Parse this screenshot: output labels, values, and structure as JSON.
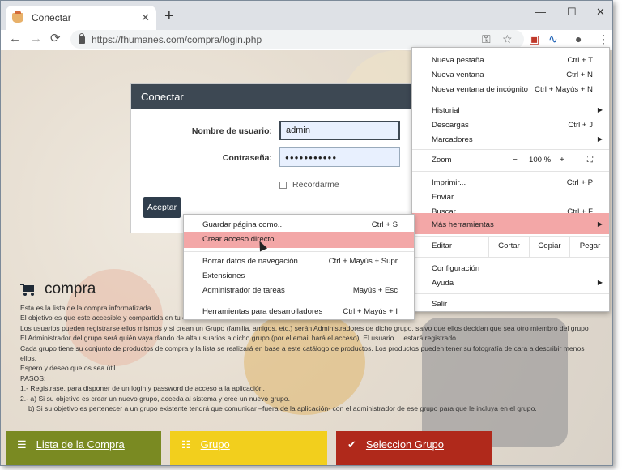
{
  "browser": {
    "tab_title": "Conectar",
    "tab_close": "✕",
    "new_tab": "+",
    "window_controls": [
      "—",
      "☐",
      "✕"
    ],
    "url": "https://fhumanes.com/compra/login.php",
    "nav": {
      "back": "←",
      "forward": "→",
      "reload": "⟳"
    },
    "toolbar_icons": {
      "key": "⚿",
      "star": "☆",
      "pdf": "▣",
      "ext": "∿",
      "profile": "●",
      "menu": "⋮"
    }
  },
  "login": {
    "title": "Conectar",
    "username_label": "Nombre de usuario:",
    "username_value": "admin",
    "password_label": "Contraseña:",
    "password_value": "●●●●●●●●●●●",
    "remember_label": "Recordarme",
    "submit_label": "Aceptar"
  },
  "page": {
    "heading": "compra",
    "description": [
      "Esta es la lista de la compra informatizada.",
      "El objetivo es que este accesible y compartida en tu casa,",
      "Los usuarios pueden registrarse ellos mismos y si crean un Grupo (familia, amigos, etc.) serán Administradores de dicho grupo, salvo que ellos decidan que sea otro miembro del grupo",
      "El Administrador del grupo será quién vaya dando de alta usuarios a dicho grupo (por el email hará el acceso). El usuario ... estará registrado.",
      "Cada grupo tiene su conjunto de productos de compra y la lista se realizará en base a este catálogo de productos. Los productos pueden tener su fotografía de cara a describir menos",
      "ellos.",
      "Espero y deseo que os sea útil.",
      "PASOS:",
      "1.- Registrase, para disponer de un login y password de acceso a la aplicación.",
      "2.- a) Si su objetivo es crear un nuevo grupo, acceda al sistema y cree un nuevo grupo.",
      "b) Si su objetivo es pertenecer a un grupo existente tendrá que comunicar –fuera de la aplicación- con el administrador de ese grupo para que le incluya en el grupo."
    ],
    "buttons": [
      {
        "label": "Lista de la Compra",
        "icon": "☰",
        "color": "#7a8a22"
      },
      {
        "label": "Grupo",
        "icon": "☷",
        "color": "#f2cf1d"
      },
      {
        "label": "Seleccion Grupo",
        "icon": "✔",
        "color": "#b0291b"
      }
    ]
  },
  "menu": {
    "items": [
      {
        "label": "Nueva pestaña",
        "shortcut": "Ctrl + T"
      },
      {
        "label": "Nueva ventana",
        "shortcut": "Ctrl + N"
      },
      {
        "label": "Nueva ventana de incógnito",
        "shortcut": "Ctrl + Mayús + N"
      },
      {
        "label": "Historial",
        "arrow": "▶"
      },
      {
        "label": "Descargas",
        "shortcut": "Ctrl + J"
      },
      {
        "label": "Marcadores",
        "arrow": "▶"
      },
      {
        "label": "Imprimir...",
        "shortcut": "Ctrl + P"
      },
      {
        "label": "Enviar..."
      },
      {
        "label": "Buscar...",
        "shortcut": "Ctrl + F"
      },
      {
        "label": "Más herramientas",
        "arrow": "▶"
      },
      {
        "label": "Configuración"
      },
      {
        "label": "Ayuda",
        "arrow": "▶"
      },
      {
        "label": "Salir"
      }
    ],
    "zoom": {
      "label": "Zoom",
      "minus": "−",
      "value": "100 %",
      "plus": "+",
      "fullscreen": "⛶"
    },
    "edit": {
      "label": "Editar",
      "cut": "Cortar",
      "copy": "Copiar",
      "paste": "Pegar"
    }
  },
  "submenu": {
    "items": [
      {
        "label": "Guardar página como...",
        "shortcut": "Ctrl + S"
      },
      {
        "label": "Crear acceso directo..."
      },
      {
        "label": "Borrar datos de navegación...",
        "shortcut": "Ctrl + Mayús + Supr"
      },
      {
        "label": "Extensiones"
      },
      {
        "label": "Administrador de tareas",
        "shortcut": "Mayús + Esc"
      },
      {
        "label": "Herramientas para desarrolladores",
        "shortcut": "Ctrl + Mayús + I"
      }
    ]
  },
  "colors": {
    "accent_highlight": "#f3a7a7",
    "login_header": "#3d4853"
  }
}
